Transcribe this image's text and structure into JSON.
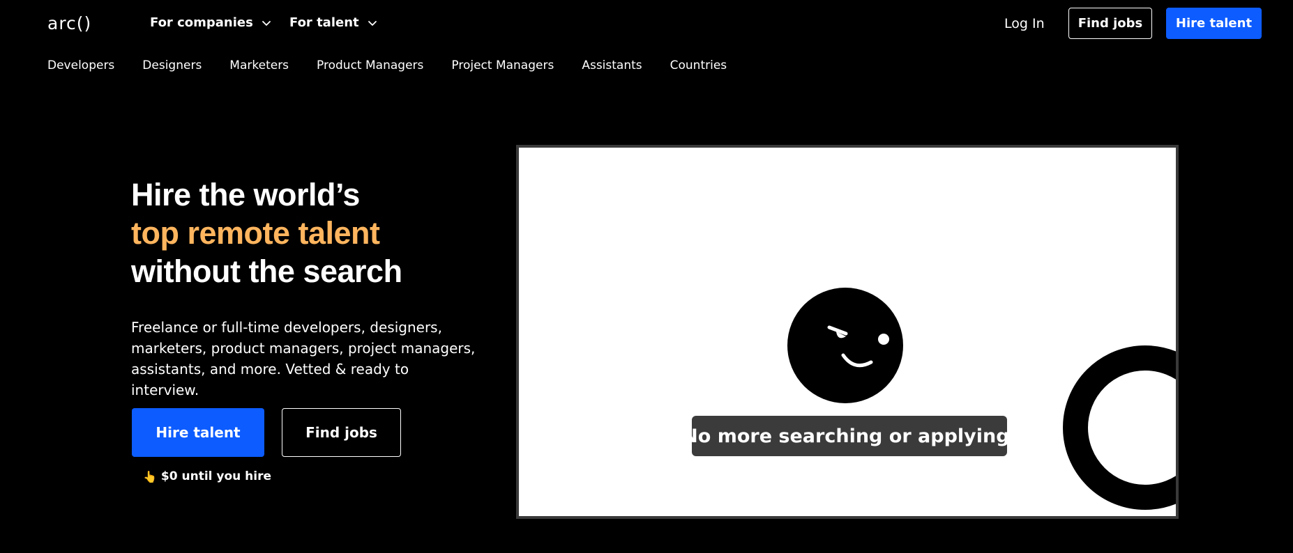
{
  "header": {
    "logo": "arc()",
    "nav_companies": "For companies",
    "nav_talent": "For talent",
    "login": "Log In",
    "find_jobs": "Find jobs",
    "hire_talent": "Hire talent"
  },
  "subnav": {
    "items": [
      "Developers",
      "Designers",
      "Marketers",
      "Product Managers",
      "Project Managers",
      "Assistants",
      "Countries"
    ]
  },
  "hero": {
    "title_line1": "Hire the world’s",
    "title_line2": "top remote talent",
    "title_line3": "without the search",
    "description": "Freelance or full-time developers, designers, marketers, product managers, project managers, assistants, and more. Vetted & ready to interview.",
    "cta_primary": "Hire talent",
    "cta_secondary": "Find jobs",
    "note": "$0 until you hire"
  },
  "video": {
    "caption": "No more searching or applying."
  },
  "colors": {
    "background": "#000000",
    "accent": "#ffb55e",
    "primary": "#0d5cff"
  },
  "icons": [
    "chevron-down-icon",
    "pointing-hand-icon",
    "winking-face-icon"
  ]
}
